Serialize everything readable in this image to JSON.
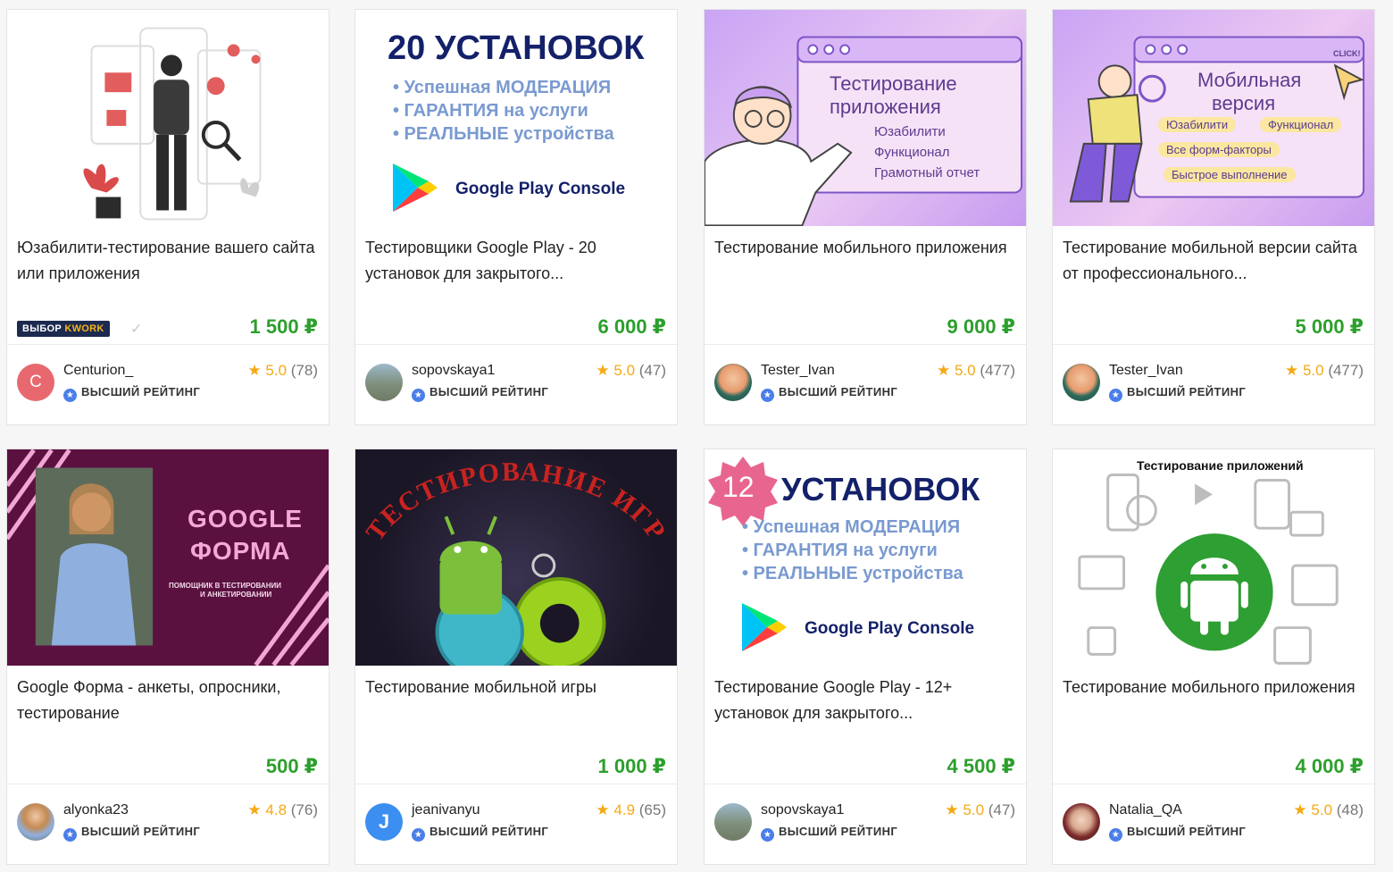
{
  "cards": [
    {
      "title": "Юзабилити-тестирование вашего сайта или приложения",
      "price": "1 500 ₽",
      "badge_prefix": "ВЫБОР",
      "badge_brand": "KWORK",
      "seller": "Centurion_",
      "avatar_letter": "C",
      "rating": "5.0",
      "reviews": "(78)",
      "top_rated": "ВЫСШИЙ РЕЙТИНГ"
    },
    {
      "title": "Тестировщики Google Play - 20 установок для закрытого...",
      "price": "6 000 ₽",
      "seller": "sopovskaya1",
      "rating": "5.0",
      "reviews": "(47)",
      "top_rated": "ВЫСШИЙ РЕЙТИНГ",
      "banner": {
        "headline": "20 УСТАНОВОК",
        "line1": "• Успешная МОДЕРАЦИЯ",
        "line2": "• ГАРАНТИЯ на услуги",
        "line3": "• РЕАЛЬНЫЕ устройства",
        "logo_text": "Google Play Console"
      }
    },
    {
      "title": "Тестирование мобильного приложения",
      "price": "9 000 ₽",
      "seller": "Tester_Ivan",
      "rating": "5.0",
      "reviews": "(477)",
      "top_rated": "ВЫСШИЙ РЕЙТИНГ",
      "banner": {
        "heading1": "Тестирование",
        "heading2": "приложения",
        "item1": "Юзабилити",
        "item2": "Функционал",
        "item3": "Грамотный отчет"
      }
    },
    {
      "title": "Тестирование мобильной версии сайта от профессионального...",
      "price": "5 000 ₽",
      "seller": "Tester_Ivan",
      "rating": "5.0",
      "reviews": "(477)",
      "top_rated": "ВЫСШИЙ РЕЙТИНГ",
      "banner": {
        "heading1": "Мобильная",
        "heading2": "версия",
        "click": "CLICK!",
        "pill1": "Юзабилити",
        "pill2": "Функционал",
        "pill3": "Все форм-факторы",
        "pill4": "Быстрое выполнение"
      }
    },
    {
      "title": "Google Форма - анкеты, опросники, тестирование",
      "price": "500 ₽",
      "seller": "alyonka23",
      "rating": "4.8",
      "reviews": "(76)",
      "top_rated": "ВЫСШИЙ РЕЙТИНГ",
      "banner": {
        "heading1": "GOOGLE",
        "heading2": "ФОРМА",
        "sub1": "ПОМОЩНИК В ТЕСТИРОВАНИИ",
        "sub2": "И АНКЕТИРОВАНИИ"
      }
    },
    {
      "title": "Тестирование мобильной игры",
      "price": "1 000 ₽",
      "seller": "jeanivanyu",
      "rating": "4.9",
      "reviews": "(65)",
      "top_rated": "ВЫСШИЙ РЕЙТИНГ",
      "banner": {
        "arc_text": "ТЕСТИРОВАНИЕ ИГР"
      }
    },
    {
      "title": "Тестирование Google Play - 12+ установок для закрытого...",
      "price": "4 500 ₽",
      "seller": "sopovskaya1",
      "rating": "5.0",
      "reviews": "(47)",
      "top_rated": "ВЫСШИЙ РЕЙТИНГ",
      "banner": {
        "number": "12",
        "headline": "УСТАНОВОК",
        "line1": "• Успешная МОДЕРАЦИЯ",
        "line2": "• ГАРАНТИЯ на услуги",
        "line3": "• РЕАЛЬНЫЕ устройства",
        "logo_text": "Google Play Console"
      }
    },
    {
      "title": "Тестирование мобильного приложения",
      "price": "4 000 ₽",
      "seller": "Natalia_QA",
      "rating": "5.0",
      "reviews": "(48)",
      "top_rated": "ВЫСШИЙ РЕЙТИНГ",
      "banner": {
        "heading": "Тестирование приложений"
      }
    }
  ],
  "colors": {
    "price": "#2c9f2c",
    "star": "#f4a915",
    "top_rated_badge": "#4a7ee8"
  }
}
